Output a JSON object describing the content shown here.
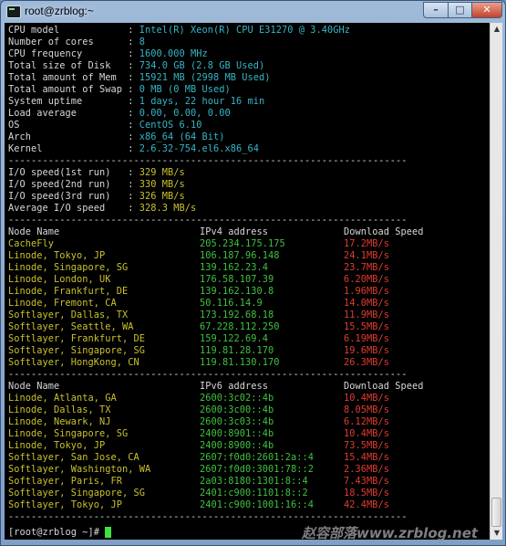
{
  "window": {
    "title": "root@zrblog:~",
    "min_glyph": "–",
    "max_glyph": "□",
    "close_glyph": "✕"
  },
  "sysinfo": [
    {
      "key": "CPU model            : ",
      "val": "Intel(R) Xeon(R) CPU E31270 @ 3.40GHz"
    },
    {
      "key": "Number of cores      : ",
      "val": "8"
    },
    {
      "key": "CPU frequency        : ",
      "val": "1600.000 MHz"
    },
    {
      "key": "Total size of Disk   : ",
      "val": "734.0 GB (2.8 GB Used)"
    },
    {
      "key": "Total amount of Mem  : ",
      "val": "15921 MB (2998 MB Used)"
    },
    {
      "key": "Total amount of Swap : ",
      "val": "0 MB (0 MB Used)"
    },
    {
      "key": "System uptime        : ",
      "val": "1 days, 22 hour 16 min"
    },
    {
      "key": "Load average         : ",
      "val": "0.00, 0.00, 0.00"
    },
    {
      "key": "OS                   : ",
      "val": "CentOS 6.10"
    },
    {
      "key": "Arch                 : ",
      "val": "x86_64 (64 Bit)"
    },
    {
      "key": "Kernel               : ",
      "val": "2.6.32-754.el6.x86_64"
    }
  ],
  "separator": "----------------------------------------------------------------------",
  "io": [
    {
      "key": "I/O speed(1st run)   : ",
      "val": "329 MB/s"
    },
    {
      "key": "I/O speed(2nd run)   : ",
      "val": "330 MB/s"
    },
    {
      "key": "I/O speed(3rd run)   : ",
      "val": "326 MB/s"
    },
    {
      "key": "Average I/O speed    : ",
      "val": "328.3 MB/s"
    }
  ],
  "ipv4_header": {
    "name": "Node Name",
    "addr": "IPv4 address",
    "speed": "Download Speed"
  },
  "ipv4_rows": [
    {
      "name": "CacheFly",
      "addr": "205.234.175.175",
      "speed": "17.2MB/s"
    },
    {
      "name": "Linode, Tokyo, JP",
      "addr": "106.187.96.148",
      "speed": "24.1MB/s"
    },
    {
      "name": "Linode, Singapore, SG",
      "addr": "139.162.23.4",
      "speed": "23.7MB/s"
    },
    {
      "name": "Linode, London, UK",
      "addr": "176.58.107.39",
      "speed": "6.20MB/s"
    },
    {
      "name": "Linode, Frankfurt, DE",
      "addr": "139.162.130.8",
      "speed": "1.96MB/s"
    },
    {
      "name": "Linode, Fremont, CA",
      "addr": "50.116.14.9",
      "speed": "14.0MB/s"
    },
    {
      "name": "Softlayer, Dallas, TX",
      "addr": "173.192.68.18",
      "speed": "11.9MB/s"
    },
    {
      "name": "Softlayer, Seattle, WA",
      "addr": "67.228.112.250",
      "speed": "15.5MB/s"
    },
    {
      "name": "Softlayer, Frankfurt, DE",
      "addr": "159.122.69.4",
      "speed": "6.19MB/s"
    },
    {
      "name": "Softlayer, Singapore, SG",
      "addr": "119.81.28.170",
      "speed": "19.6MB/s"
    },
    {
      "name": "Softlayer, HongKong, CN",
      "addr": "119.81.130.170",
      "speed": "26.3MB/s"
    }
  ],
  "ipv6_header": {
    "name": "Node Name",
    "addr": "IPv6 address",
    "speed": "Download Speed"
  },
  "ipv6_rows": [
    {
      "name": "Linode, Atlanta, GA",
      "addr": "2600:3c02::4b",
      "speed": "10.4MB/s"
    },
    {
      "name": "Linode, Dallas, TX",
      "addr": "2600:3c00::4b",
      "speed": "8.05MB/s"
    },
    {
      "name": "Linode, Newark, NJ",
      "addr": "2600:3c03::4b",
      "speed": "6.12MB/s"
    },
    {
      "name": "Linode, Singapore, SG",
      "addr": "2400:8901::4b",
      "speed": "10.4MB/s"
    },
    {
      "name": "Linode, Tokyo, JP",
      "addr": "2400:8900::4b",
      "speed": "73.5MB/s"
    },
    {
      "name": "Softlayer, San Jose, CA",
      "addr": "2607:f0d0:2601:2a::4",
      "speed": "15.4MB/s"
    },
    {
      "name": "Softlayer, Washington, WA",
      "addr": "2607:f0d0:3001:78::2",
      "speed": "2.36MB/s"
    },
    {
      "name": "Softlayer, Paris, FR",
      "addr": "2a03:8180:1301:8::4",
      "speed": "7.43MB/s"
    },
    {
      "name": "Softlayer, Singapore, SG",
      "addr": "2401:c900:1101:8::2",
      "speed": "18.5MB/s"
    },
    {
      "name": "Softlayer, Tokyo, JP",
      "addr": "2401:c900:1001:16::4",
      "speed": "42.4MB/s"
    }
  ],
  "prompt": "[root@zrblog ~]# ",
  "watermark": "赵容部落www.zrblog.net"
}
